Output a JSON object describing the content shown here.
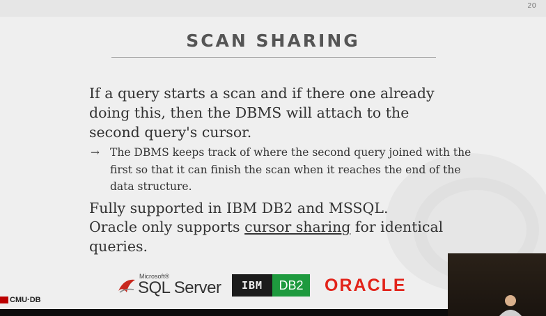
{
  "slide": {
    "page_number": "20",
    "title": "SCAN SHARING",
    "paragraph1": "If a query starts a scan and if there one already doing this, then the DBMS will attach to the second query's cursor.",
    "bullet_arrow": "→",
    "bullet_text": "The DBMS keeps track of where the second query joined with the first so that it can finish the scan when it reaches the end of the data structure.",
    "paragraph2": "Fully supported in IBM DB2 and MSSQL.",
    "paragraph3_prefix": "Oracle only supports ",
    "paragraph3_link": "cursor sharing",
    "paragraph3_suffix": " for identical queries."
  },
  "logos": {
    "sql_server_small": "Microsoft®",
    "sql_server": "SQL Server",
    "ibm": "IBM",
    "db2": "DB2",
    "oracle": "ORACLE"
  },
  "footer": {
    "brand": "CMU·DB"
  },
  "colors": {
    "oracle_red": "#e2231a",
    "db2_green": "#1e9a3e",
    "title_gray": "#555555"
  },
  "icons": {
    "sql_server_logo": "sql-server-flag-icon",
    "cmu_logo": "cmu-db-icon"
  }
}
